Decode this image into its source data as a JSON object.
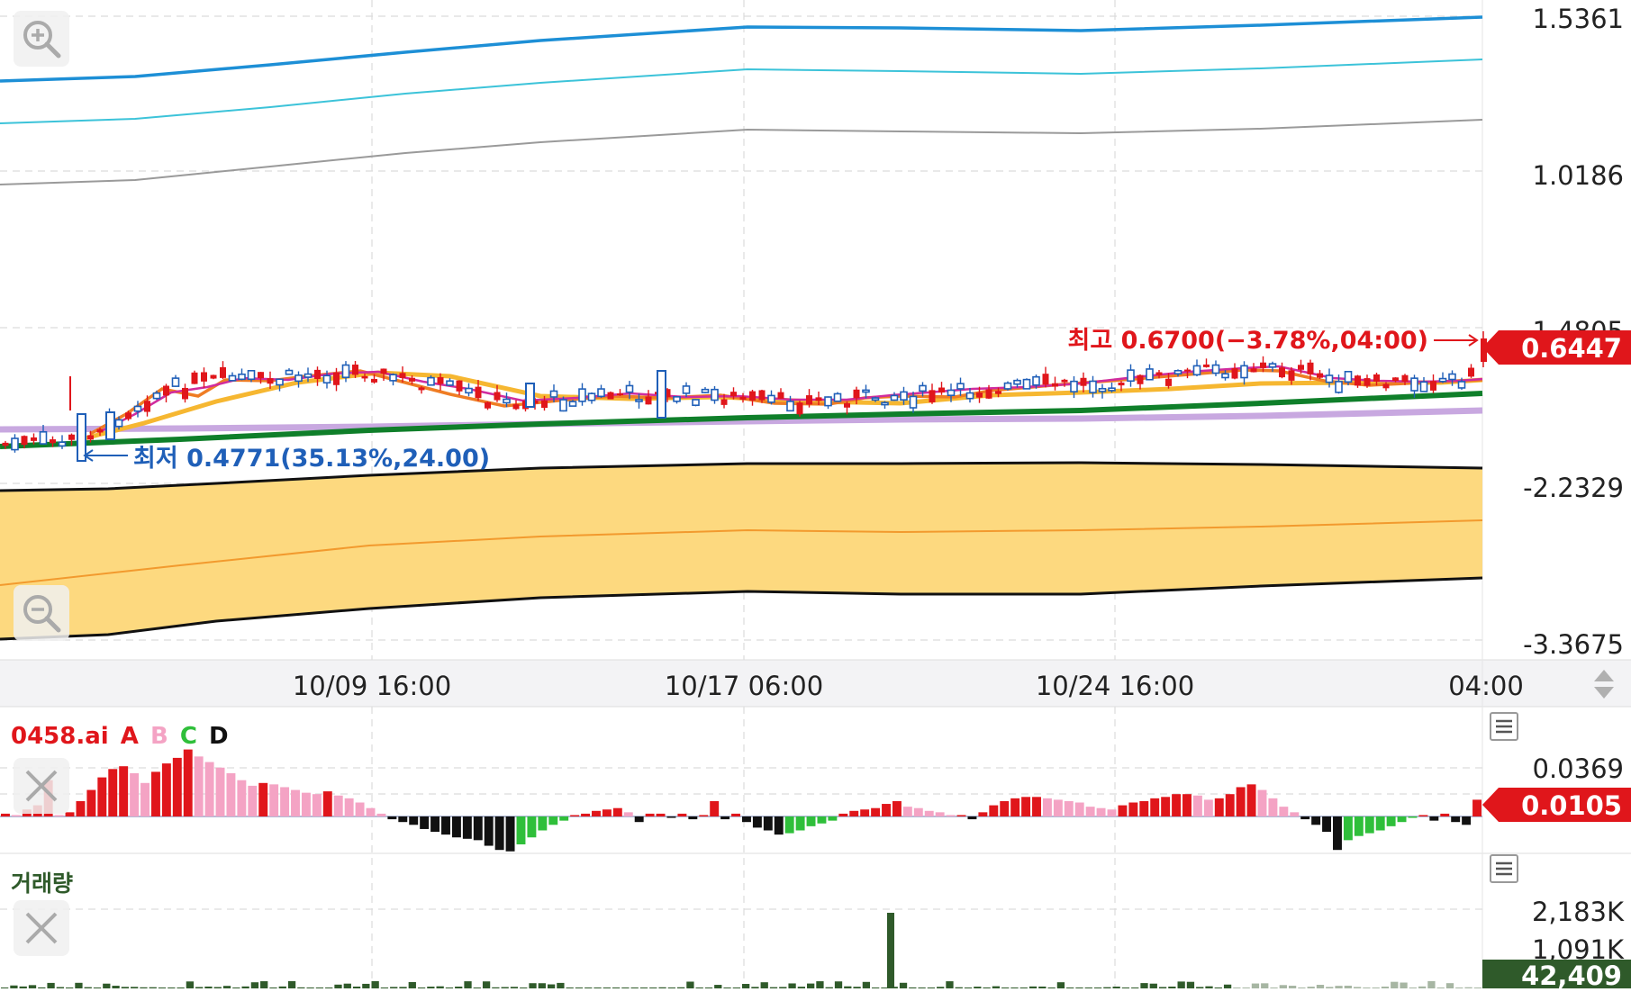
{
  "chart_data": [
    {
      "type": "candlestick",
      "panel": "price",
      "x_ticks": [
        "10/09 16:00",
        "10/17 06:00",
        "10/24 16:00",
        "04:00"
      ],
      "y_ticks": [
        "1.5361",
        "1.0186",
        "-1.4805",
        "-2.2329",
        "-3.3675"
      ],
      "current_price": "0.6447",
      "high_annotation": "최고 0.6700(−3.78%,04:00)",
      "low_annotation": "최저 0.4771(35.13%,24.00)",
      "high": 0.67,
      "low": 0.4771,
      "overlays": [
        "upper band lines",
        "moving averages",
        "cloud band"
      ]
    },
    {
      "type": "bar",
      "panel": "indicator",
      "title": "0458.ai",
      "legend": [
        "A",
        "B",
        "C",
        "D"
      ],
      "y_ticks": [
        "0.0369"
      ],
      "current_value": "0.0105",
      "values": [
        0.2,
        0.1,
        0.5,
        0.8,
        2.6,
        0.1,
        0.3,
        1.1,
        1.9,
        2.8,
        3.4,
        3.6,
        3.1,
        2.4,
        3.2,
        3.8,
        4.2,
        4.8,
        4.3,
        3.9,
        3.5,
        3.1,
        2.6,
        2.2,
        2.4,
        2.3,
        2.1,
        1.9,
        1.7,
        1.6,
        1.8,
        1.5,
        1.3,
        1.0,
        0.6,
        0.2,
        -0.2,
        -0.4,
        -0.6,
        -0.9,
        -1.1,
        -1.3,
        -1.5,
        -1.6,
        -1.7,
        -2.1,
        -2.4,
        -2.5,
        -2.0,
        -1.5,
        -1.0,
        -0.6,
        -0.3,
        0.0,
        0.2,
        0.4,
        0.5,
        0.6,
        0.3,
        -0.4,
        0.2,
        0.2,
        -0.1,
        0.2,
        -0.2,
        0.1,
        1.1,
        -0.2,
        0.2,
        -0.4,
        -0.8,
        -1.0,
        -1.3,
        -1.2,
        -1.0,
        -0.7,
        -0.5,
        -0.3,
        0.2,
        0.4,
        0.5,
        0.6,
        0.9,
        1.1,
        0.7,
        0.6,
        0.4,
        0.3,
        0.1,
        0.1,
        -0.2,
        0.3,
        0.8,
        1.1,
        1.3,
        1.4,
        1.4,
        1.3,
        1.2,
        1.1,
        1.0,
        0.7,
        0.6,
        0.5,
        0.8,
        1.0,
        1.1,
        1.3,
        1.4,
        1.6,
        1.6,
        1.5,
        1.2,
        1.3,
        1.6,
        2.1,
        2.3,
        1.9,
        1.3,
        0.7,
        0.3,
        -0.2,
        -0.6,
        -1.1,
        -2.4,
        -1.7,
        -1.4,
        -1.2,
        -1.0,
        -0.7,
        -0.4,
        -0.1,
        0.1,
        -0.3,
        0.2,
        -0.4,
        -0.6,
        1.2
      ]
    },
    {
      "type": "bar",
      "panel": "volume",
      "title": "거래량",
      "y_ticks": [
        "2,183K",
        "1,091K"
      ],
      "current_value": "42,409",
      "spike_value_k": 2183
    }
  ],
  "colors": {
    "up": "#e0161b",
    "down": "#1f5fb8",
    "indicator_pos_strong": "#e0161b",
    "indicator_pos_weak": "#f4a3c4",
    "indicator_neg_weak": "#2fbf3a",
    "indicator_neg_strong": "#111111",
    "volume": "#2f5a2a",
    "cloud": "#fdd97f"
  },
  "icons": {
    "zoom_in": "zoom-in-icon",
    "zoom_out": "zoom-out-icon",
    "close": "close-icon",
    "menu": "menu-icon",
    "scroll": "up-down-arrows-icon"
  }
}
